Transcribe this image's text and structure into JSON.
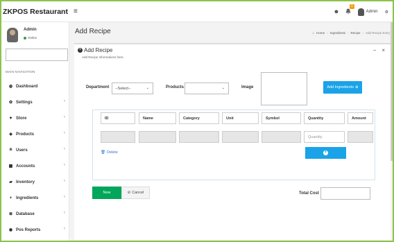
{
  "app": {
    "brand": "ZKPOS Restaurant"
  },
  "topbar": {
    "notification_count": "1",
    "user": "Admin"
  },
  "sidebar": {
    "user_name": "Admin",
    "status": "Online",
    "search_placeholder": "",
    "nav_header": "MAIN NAVIGATION",
    "items": [
      {
        "label": "Dashboard",
        "icon": "dashboard-icon",
        "chevron": false
      },
      {
        "label": "Settings",
        "icon": "gear-icon",
        "chevron": true
      },
      {
        "label": "Store",
        "icon": "thumbtack-icon",
        "chevron": true
      },
      {
        "label": "Products",
        "icon": "tag-icon",
        "chevron": true
      },
      {
        "label": "Users",
        "icon": "user-icon",
        "chevron": true
      },
      {
        "label": "Accounts",
        "icon": "calculator-icon",
        "chevron": true
      },
      {
        "label": "Inventory",
        "icon": "truck-icon",
        "chevron": true
      },
      {
        "label": "Ingredients",
        "icon": "plus-icon",
        "chevron": true
      },
      {
        "label": "Database",
        "icon": "database-icon",
        "chevron": true
      },
      {
        "label": "Pos Reports",
        "icon": "report-icon",
        "chevron": true
      }
    ]
  },
  "page": {
    "title": "Add Recipe",
    "breadcrumb": [
      "Home",
      "Ingredients",
      "Recipe",
      "Add Recipe Entry"
    ]
  },
  "box": {
    "title": "Add Recipe",
    "subtitle": "Add Recipe Informations here.",
    "collapse": "−",
    "close": "×"
  },
  "form": {
    "department_label": "Department",
    "department_value": "--Select--",
    "products_label": "Products",
    "products_value": "",
    "image_label": "Image",
    "add_ingredients_label": "Add Ingredients"
  },
  "table": {
    "headers": [
      "ID",
      "Name",
      "Category",
      "Unit",
      "Symbol",
      "Quantity",
      "Amount"
    ],
    "quantity_placeholder": "Quantity",
    "delete_label": "Delete"
  },
  "footer": {
    "new_label": "New",
    "cancel_label": "Cancel",
    "total_cost_label": "Total Cost",
    "total_cost_value": ""
  },
  "colors": {
    "primary": "#1aa3e8",
    "success": "#00a65a",
    "frame": "#8bc34a"
  }
}
